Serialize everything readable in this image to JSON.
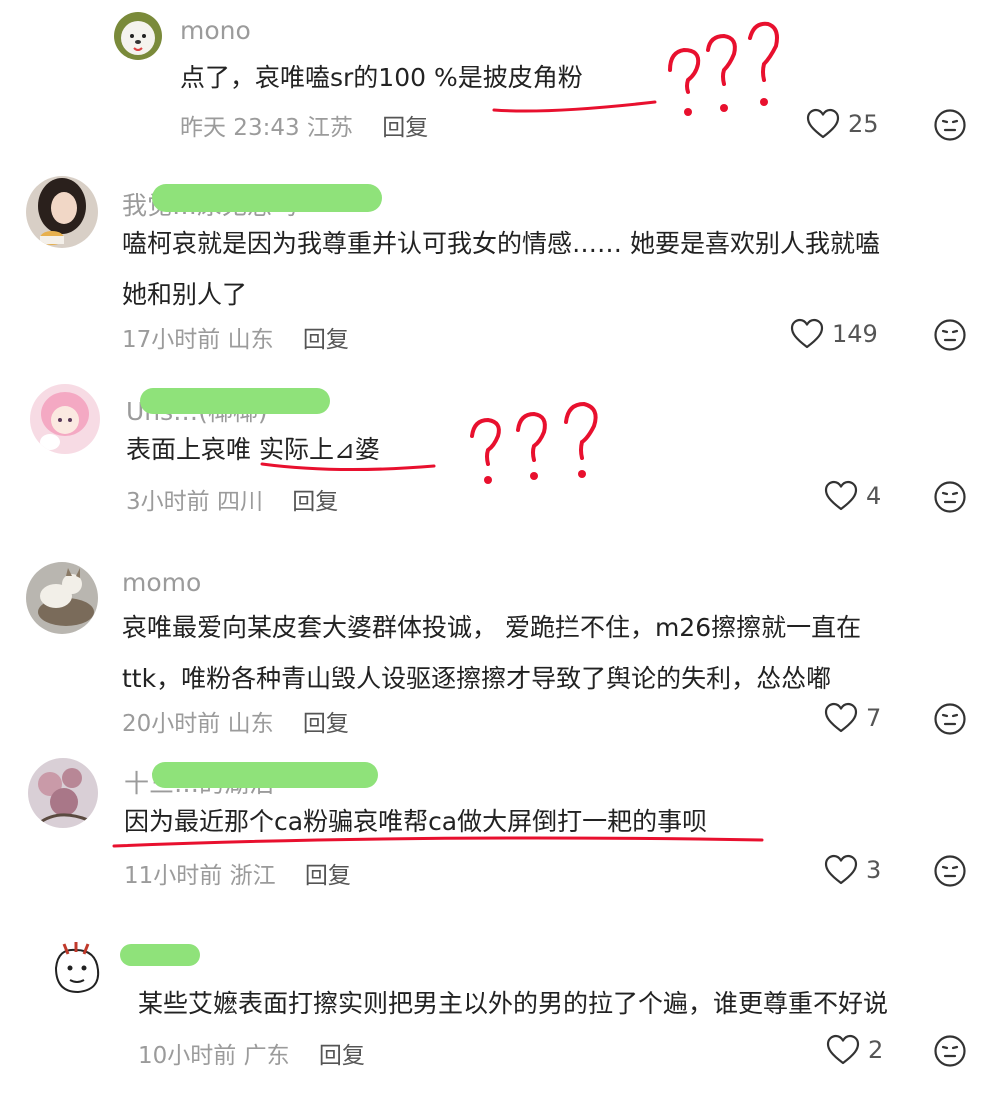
{
  "comments": [
    {
      "username": "mono",
      "lines": [
        "点了，哀唯嗑sr的100 %是披皮角粉"
      ],
      "time": "昨天 23:43",
      "location": "江苏",
      "reply_label": "回复",
      "likes": "25",
      "avatar": "dog-avatar",
      "annotation": "???"
    },
    {
      "username": "我觉…尿无恙吗",
      "lines": [
        "嗑柯哀就是因为我尊重并认可我女的情感…… 她要是喜欢别人我就嗑",
        "她和别人了"
      ],
      "time": "17小时前",
      "location": "山东",
      "reply_label": "回复",
      "likes": "149",
      "avatar": "girl-avatar"
    },
    {
      "username": "Uns…(椰椰)",
      "lines": [
        "表面上哀唯 实际上⊿婆"
      ],
      "time": "3小时前",
      "location": "四川",
      "reply_label": "回复",
      "likes": "4",
      "avatar": "anime-avatar",
      "annotation": "???"
    },
    {
      "username": "momo",
      "lines": [
        "哀唯最爱向某皮套大婆群体投诚， 爱跪拦不住，m26擦擦就一直在",
        "ttk，唯粉各种青山毁人设驱逐擦擦才导致了舆论的失利，怂怂嘟"
      ],
      "time": "20小时前",
      "location": "山东",
      "reply_label": "回复",
      "likes": "7",
      "avatar": "cat-avatar"
    },
    {
      "username": "十三…的湖泊",
      "lines": [
        "因为最近那个ca粉骗哀唯帮ca做大屏倒打一耙的事呗"
      ],
      "time": "11小时前",
      "location": "浙江",
      "reply_label": "回复",
      "likes": "3",
      "avatar": "flower-avatar"
    },
    {
      "username": "",
      "lines": [
        "某些艾嬷表面打擦实则把男主以外的男的拉了个遍，谁更尊重不好说"
      ],
      "time": "10小时前",
      "location": "广东",
      "reply_label": "回复",
      "likes": "2",
      "avatar": "doodle-dog-avatar"
    }
  ],
  "icons": {
    "like": "heart-outline-icon",
    "reaction": "neutral-face-icon"
  },
  "colors": {
    "annotation_red": "#e8102e",
    "redaction_green": "#8fe27a",
    "username_gray": "#9b9b9b"
  }
}
